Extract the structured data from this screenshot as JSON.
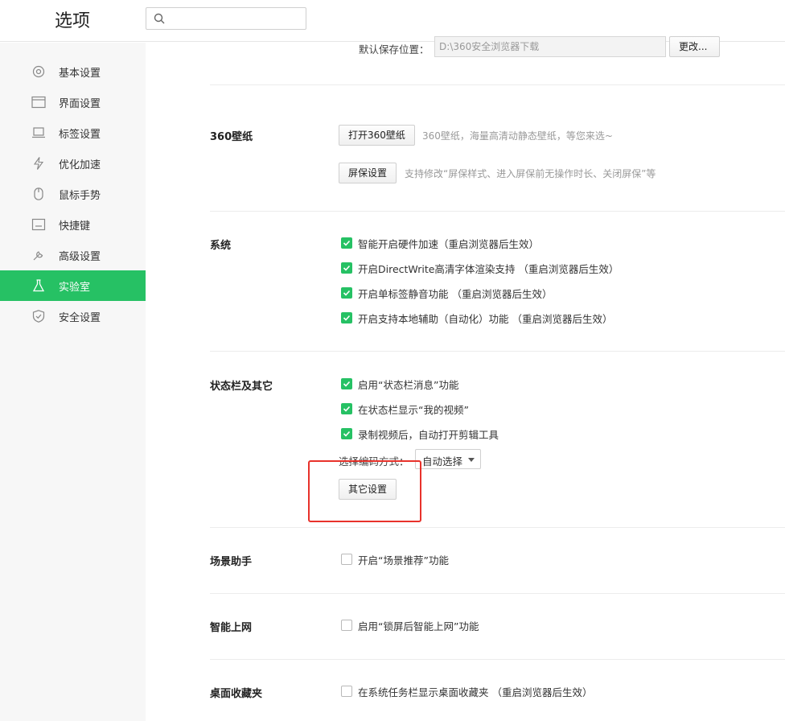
{
  "header": {
    "title": "选项",
    "search_placeholder": ""
  },
  "sidebar": {
    "items": [
      {
        "label": "基本设置",
        "icon": "gear-icon"
      },
      {
        "label": "界面设置",
        "icon": "window-icon"
      },
      {
        "label": "标签设置",
        "icon": "laptop-icon"
      },
      {
        "label": "优化加速",
        "icon": "lightning-icon"
      },
      {
        "label": "鼠标手势",
        "icon": "mouse-icon"
      },
      {
        "label": "快捷键",
        "icon": "keyboard-icon"
      },
      {
        "label": "高级设置",
        "icon": "wrench-icon"
      },
      {
        "label": "实验室",
        "icon": "flask-icon"
      },
      {
        "label": "安全设置",
        "icon": "shield-icon"
      }
    ],
    "active": "实验室"
  },
  "download": {
    "label": "默认保存位置：",
    "path": "D:\\360安全浏览器下载",
    "change_button": "更改..."
  },
  "wallpaper": {
    "title": "360壁纸",
    "open_button": "打开360壁纸",
    "open_hint": "360壁纸，海量高清动静态壁纸，等您来选~",
    "screensaver_button": "屏保设置",
    "screensaver_hint": "支持修改“屏保样式、进入屏保前无操作时长、关闭屏保”等"
  },
  "system": {
    "title": "系统",
    "options": [
      {
        "label": "智能开启硬件加速（重启浏览器后生效）",
        "checked": true
      },
      {
        "label": "开启DirectWrite高清字体渲染支持 （重启浏览器后生效）",
        "checked": true
      },
      {
        "label": "开启单标签静音功能  （重启浏览器后生效）",
        "checked": true
      },
      {
        "label": "开启支持本地辅助（自动化）功能  （重启浏览器后生效）",
        "checked": true
      }
    ]
  },
  "statusbar": {
    "title": "状态栏及其它",
    "options": [
      {
        "label": "启用“状态栏消息”功能",
        "checked": true
      },
      {
        "label": "在状态栏显示“我的视频”",
        "checked": true
      },
      {
        "label": "录制视频后，自动打开剪辑工具",
        "checked": true
      }
    ],
    "encode_label": "选择编码方式：",
    "encode_value": "自动选择",
    "other_button": "其它设置"
  },
  "scene": {
    "title": "场景助手",
    "option": {
      "label": "开启“场景推荐”功能",
      "checked": false
    }
  },
  "smart": {
    "title": "智能上网",
    "option": {
      "label": "启用“锁屏后智能上网”功能",
      "checked": false
    }
  },
  "desktop_fav": {
    "title": "桌面收藏夹",
    "option": {
      "label": "在系统任务栏显示桌面收藏夹 （重启浏览器后生效）",
      "checked": false
    }
  },
  "colors": {
    "accent": "#26c164",
    "highlight": "#e8322b"
  }
}
